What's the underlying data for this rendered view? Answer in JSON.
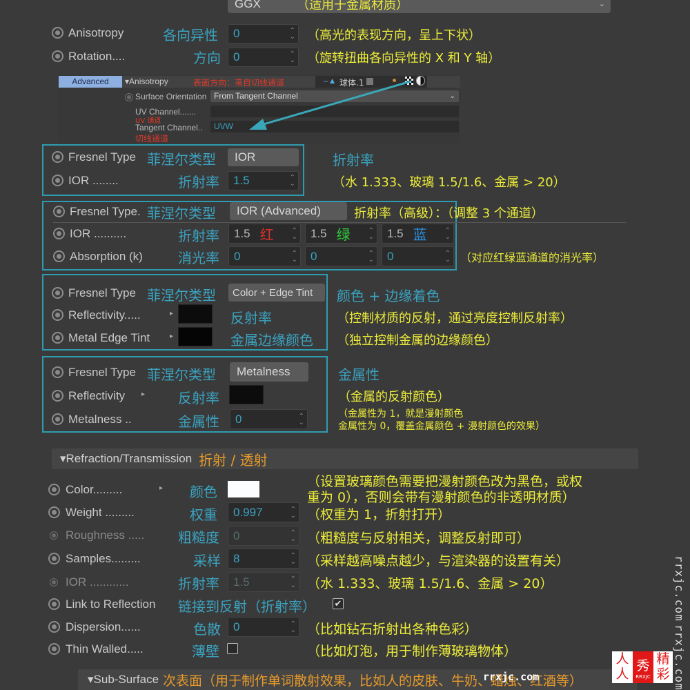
{
  "top": {
    "distribution_value": "GGX",
    "distribution_note": "（适用于金属材质）"
  },
  "anisotropy": {
    "rows": [
      {
        "label": "Anisotropy",
        "cn": "各向异性",
        "value": "0",
        "note": "（高光的表现方向，呈上下状）"
      },
      {
        "label": "Rotation....",
        "cn": "方向",
        "value": "0",
        "note": "（旋转扭曲各向异性的 X 和 Y 轴）"
      }
    ]
  },
  "inset": {
    "tab_label": "Advanced",
    "section_label": "▾Anisotropy",
    "section_note": "表面方向：来自切线通道",
    "object_name": "球体.1",
    "surface_orientation_label": "Surface Orientation",
    "surface_orientation_value": "From Tangent Channel",
    "uv_channel_label": "UV Channel.......",
    "uv_channel_note": "UV 通道",
    "uv_channel_value": "",
    "tangent_channel_label": "Tangent Channel..",
    "tangent_channel_value": "UVW",
    "tangent_channel_note": "切线通道"
  },
  "fresnel_ior": {
    "type_label": "Fresnel Type",
    "type_cn": "菲涅尔类型",
    "type_value": "IOR",
    "ior_label": "IOR ........",
    "ior_cn": "折射率",
    "ior_value": "1.5",
    "title_note": "折射率",
    "note": "（水 1.333、玻璃 1.5/1.6、金属 > 20）"
  },
  "fresnel_ior_adv": {
    "type_label": "Fresnel Type.",
    "type_cn": "菲涅尔类型",
    "type_value": "IOR (Advanced)",
    "type_note": "折射率（高级）：（调整 3 个通道）",
    "ior_label": "IOR ..........",
    "ior_cn": "折射率",
    "ior_values": [
      {
        "value": "1.5",
        "channel": "红",
        "color": "#e0302a"
      },
      {
        "value": "1.5",
        "channel": "绿",
        "color": "#2fcf3a"
      },
      {
        "value": "1.5",
        "channel": "蓝",
        "color": "#2a8fe0"
      }
    ],
    "absorption_label": "Absorption (k)",
    "absorption_cn": "消光率",
    "absorption_values": [
      "0",
      "0",
      "0"
    ],
    "absorption_note": "（对应红绿蓝通道的消光率）"
  },
  "fresnel_color_edge": {
    "type_label": "Fresnel Type",
    "type_cn": "菲涅尔类型",
    "type_value": "Color + Edge Tint",
    "type_note": "颜色 + 边缘着色",
    "reflectivity_label": "Reflectivity.....",
    "reflectivity_cn": "反射率",
    "reflectivity_note": "（控制材质的反射，通过亮度控制反射率）",
    "edge_label": "Metal Edge Tint",
    "edge_cn": "金属边缘颜色",
    "edge_note": "（独立控制金属的边缘颜色）"
  },
  "fresnel_metalness": {
    "type_label": "Fresnel Type",
    "type_cn": "菲涅尔类型",
    "type_value": "Metalness",
    "type_note": "金属性",
    "reflectivity_label": "Reflectivity",
    "reflectivity_cn": "反射率",
    "reflectivity_note": "（金属的反射颜色）",
    "metalness_label": "Metalness ..",
    "metalness_cn": "金属性",
    "metalness_value": "0",
    "metalness_note_1": "（金属性为 1，就是漫射颜色",
    "metalness_note_2": "金属性为 0，覆盖金属颜色 + 漫射颜色的效果）"
  },
  "refraction": {
    "header_label": "▾Refraction/Transmission",
    "header_cn": "折射 / 透射",
    "rows": [
      {
        "label": "Color.........",
        "cn": "颜色",
        "note": "（设置玻璃颜色需要把漫射颜色改为黑色，或权",
        "note2": "重为 0），否则会带有漫射颜色的非透明材质）"
      },
      {
        "label": "Weight .........",
        "cn": "权重",
        "value": "0.997",
        "note": "（权重为 1，折射打开）"
      },
      {
        "label": "Roughness .....",
        "cn": "粗糙度",
        "value": "0",
        "note": "（粗糙度与反射相关，调整反射即可）"
      },
      {
        "label": "Samples.........",
        "cn": "采样",
        "value": "8",
        "note": "（采样越高噪点越少，与渲染器的设置有关）"
      },
      {
        "label": "IOR ............",
        "cn": "折射率",
        "value": "1.5",
        "note": "（水 1.333、玻璃 1.5/1.6、金属 > 20）"
      },
      {
        "label": "Link to Reflection",
        "cn": "链接到反射（折射率）",
        "checked": true
      },
      {
        "label": "Dispersion......",
        "cn": "色散",
        "value": "0",
        "note": "（比如钻石折射出各种色彩）"
      },
      {
        "label": "Thin Walled.....",
        "cn": "薄壁",
        "checked": false,
        "note": "（比如灯泡，用于制作薄玻璃物体）"
      }
    ]
  },
  "subsurface": {
    "header_label": "▾Sub-Surface",
    "header_note": "次表面（用于制作单词散射效果，比如人的皮肤、牛奶、蜡烛、红酒等）"
  },
  "watermark": {
    "vertical_1": "rrxjc.com",
    "vertical_2": "rrxjc.com",
    "inline": "rrxjc.com",
    "logo_chars": [
      "人",
      "人",
      "秀",
      "精",
      "彩"
    ],
    "logo_sub": "RRXJC"
  }
}
